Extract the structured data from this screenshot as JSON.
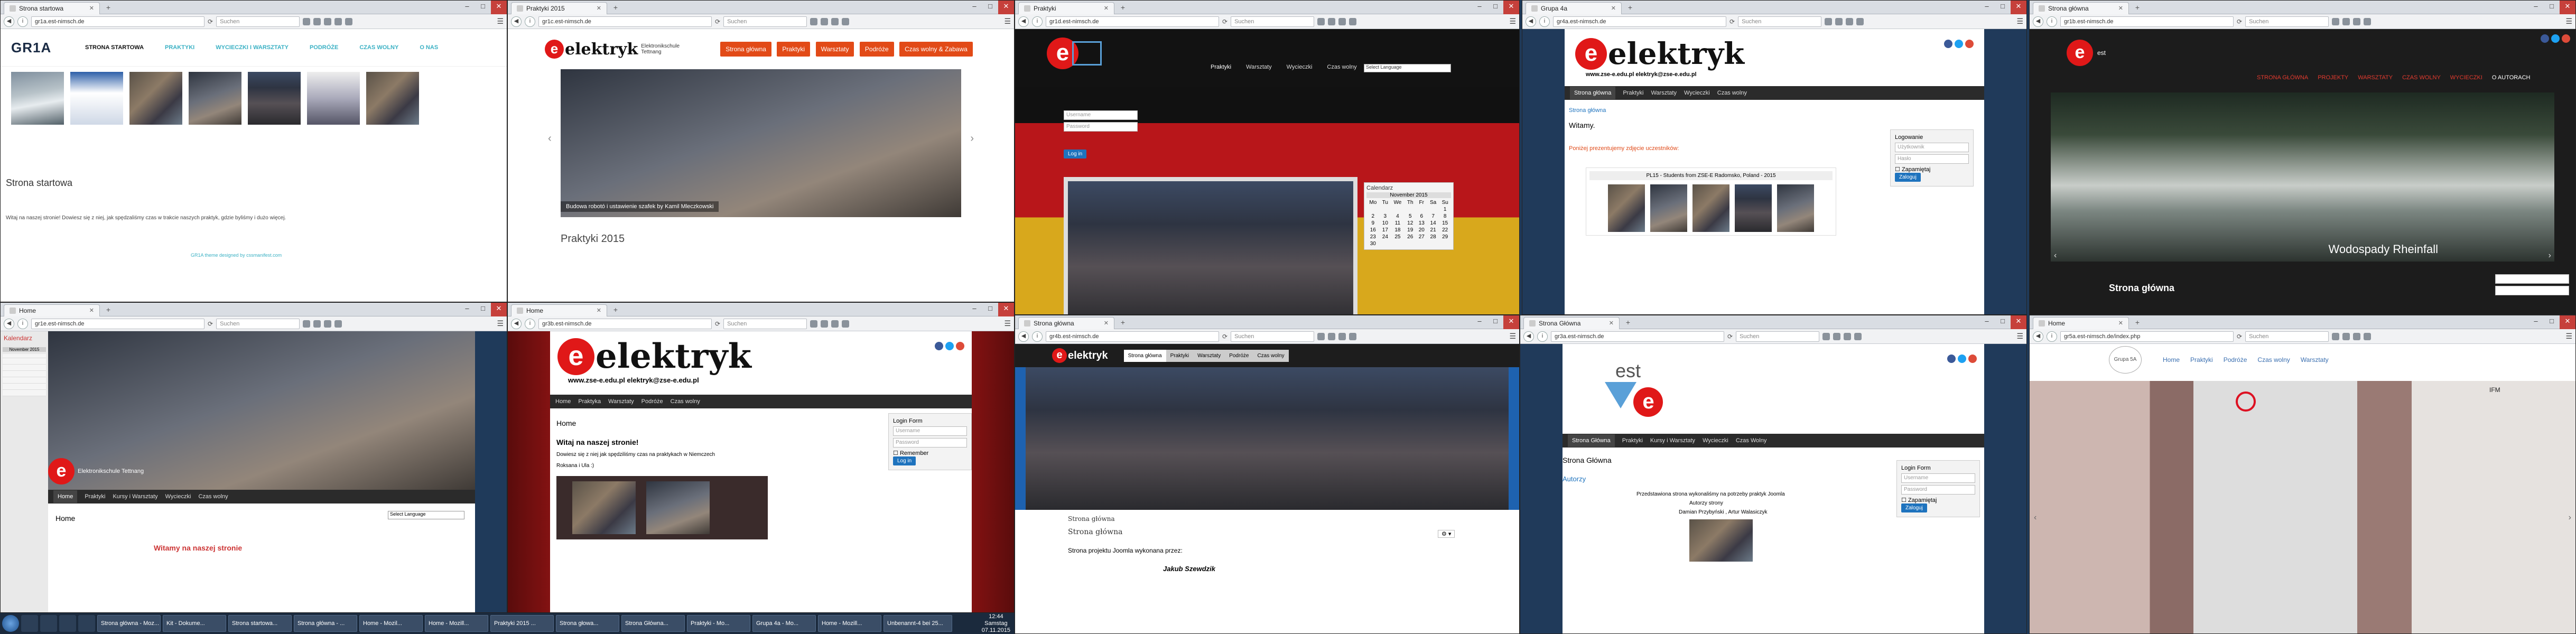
{
  "url": "gr1a.est-nimsch.de",
  "search_placeholder": "Suchen",
  "windows": [
    {
      "tab": "Strona startowa",
      "url": "gr1a.est-nimsch.de"
    },
    {
      "tab": "Praktyki 2015",
      "url": "gr1c.est-nimsch.de"
    },
    {
      "tab": "Praktyki",
      "url": "gr1d.est-nimsch.de"
    },
    {
      "tab": "Grupa 4a",
      "url": "gr4a.est-nimsch.de"
    },
    {
      "tab": "Strona główna",
      "url": "gr1b.est-nimsch.de"
    },
    {
      "tab": "Home",
      "url": "gr1e.est-nimsch.de"
    },
    {
      "tab": "Home",
      "url": "gr3b.est-nimsch.de"
    },
    {
      "tab": "Strona główna",
      "url": "gr4b.est-nimsch.de"
    },
    {
      "tab": "Strona Główna",
      "url": "gr3a.est-nimsch.de"
    },
    {
      "tab": "Home",
      "url": "gr5a.est-nimsch.de/index.php"
    }
  ],
  "w1": {
    "logo": "GR1A",
    "nav": [
      "STRONA STARTOWA",
      "PRAKTYKI",
      "WYCIECZKI I WARSZTATY",
      "PODRÓŻE",
      "CZAS WOLNY",
      "O NAS"
    ],
    "heading": "Strona startowa",
    "text": "Witaj na naszej stronie! Dowiesz się z niej, jak spędzaliśmy czas w trakcie naszych praktyk, gdzie byliśmy i dużo więcej.",
    "footer": "GR1A theme designed by cssmanifest.com"
  },
  "w2": {
    "logo_word": "elektryk",
    "logo_sub": "Elektronikschule Tettnang",
    "menu": [
      "Strona główna",
      "Praktyki",
      "Warsztaty",
      "Podróże",
      "Czas wolny & Zabawa"
    ],
    "caption": "Budowa robotó i ustawienie szafek by Kamil Mleczkowski",
    "title": "Praktyki 2015"
  },
  "w3": {
    "nav": [
      "Praktyki",
      "Warsztaty",
      "Wycieczki",
      "Czas wolny"
    ],
    "select": "Select Language",
    "user_placeholder": "Username",
    "pass_placeholder": "Password",
    "login": "Log in",
    "cal_title": "Calendarz",
    "cal_month": "November 2015",
    "cal_days": [
      "Mo",
      "Tu",
      "We",
      "Th",
      "Fr",
      "Sa",
      "Su"
    ],
    "cal_rows": [
      [
        "",
        "",
        "",
        "",
        "",
        "",
        "1"
      ],
      [
        "2",
        "3",
        "4",
        "5",
        "6",
        "7",
        "8"
      ],
      [
        "9",
        "10",
        "11",
        "12",
        "13",
        "14",
        "15"
      ],
      [
        "16",
        "17",
        "18",
        "19",
        "20",
        "21",
        "22"
      ],
      [
        "23",
        "24",
        "25",
        "26",
        "27",
        "28",
        "29"
      ],
      [
        "30",
        "",
        "",
        "",
        "",
        "",
        ""
      ]
    ]
  },
  "w4": {
    "logo_word": "elektryk",
    "logo_sub": "www.zse-e.edu.pl   elektryk@zse-e.edu.pl",
    "nav": [
      "Strona główna",
      "Praktyki",
      "Warsztaty",
      "Wycieczki",
      "Czas wolny"
    ],
    "crumb": "Strona główna",
    "welcome": "Witamy.",
    "intro": "Poniżej prezentujemy zdjęcie uczestników:",
    "group": "PL15 - Students from ZSE-E Radomsko, Poland - 2015",
    "login_title": "Logowanie",
    "user_placeholder": "Użytkownik",
    "pass_placeholder": "Hasło",
    "remember": "Zapamiętaj",
    "login": "Zaloguj"
  },
  "w5": {
    "nav": [
      "STRONA GŁÓWNA",
      "PROJEKTY",
      "WARSZTATY",
      "CZAS WOLNY",
      "WYCIECZKI",
      "O AUTORACH"
    ],
    "caption": "Wodospady Rheinfall",
    "title": "Strona główna"
  },
  "w6": {
    "side_title": "Kalendarz",
    "cal_month": "November 2015",
    "school": "Elektronikschule Tettnang",
    "nav": [
      "Home",
      "Praktyki",
      "Kursy i Warsztaty",
      "Wycieczki",
      "Czas wolny"
    ],
    "heading": "Home",
    "select": "Select Language",
    "welcome": "Witamy na naszej stronie"
  },
  "w7": {
    "logo_word": "elektryk",
    "logo_sub": "www.zse-e.edu.pl   elektryk@zse-e.edu.pl",
    "nav": [
      "Home",
      "Praktyka",
      "Warsztaty",
      "Podróże",
      "Czas wolny"
    ],
    "heading": "Home",
    "welcome": "Witaj na naszej stronie!",
    "text": "Dowiesz się z niej jak spędziliśmy czas na praktykach w Niemczech",
    "sign": "Roksana i Ula :)",
    "login_title": "Login Form",
    "user_placeholder": "Username",
    "pass_placeholder": "Password",
    "remember": "Remember",
    "login": "Log in"
  },
  "w8": {
    "logo_word": "elektryk",
    "nav": [
      "Strona główna",
      "Praktyki",
      "Warsztaty",
      "Podróże",
      "Czas wolny"
    ],
    "crumb": "Strona główna",
    "heading": "Strona główna",
    "text": "Strona projektu Joomla wykonana przez:",
    "author": "Jakub Szewdzik"
  },
  "w9": {
    "logo_word": "est",
    "nav": [
      "Strona Główna",
      "Praktyki",
      "Kursy i Warsztaty",
      "Wycieczki",
      "Czas Wolny"
    ],
    "heading": "Strona Główna",
    "sub": "Autorzy",
    "text": "Przedstawiona strona wykonaliśmy na potrzeby praktyk Joomla",
    "authors_title": "Autorzy strony",
    "authors": "Damian Przybyński , Artur Walasiczyk",
    "login_title": "Login Form",
    "user_placeholder": "Username",
    "pass_placeholder": "Password",
    "remember": "Zapamiętaj",
    "login": "Zaloguj"
  },
  "w10": {
    "logo": "Grupa 5A",
    "nav": [
      "Home",
      "Praktyki",
      "Podróże",
      "Czas wolny",
      "Warsztaty"
    ],
    "sign": "IFM"
  },
  "taskbar": {
    "items": [
      "Strona główna - Moz...",
      "Kit - Dokume...",
      "Strona startowa...",
      "Strona główna - ...",
      "Home - Mozil...",
      "Home - Mozill...",
      "Praktyki 2015 ...",
      "Strona głowa...",
      "Strona Główna...",
      "Praktyki - Mo...",
      "Grupa 4a - Mo...",
      "Home - Mozill...",
      "Unbenannt-4 bei 25..."
    ],
    "time": "12:44",
    "day": "Samstag",
    "date": "07.11.2015"
  }
}
